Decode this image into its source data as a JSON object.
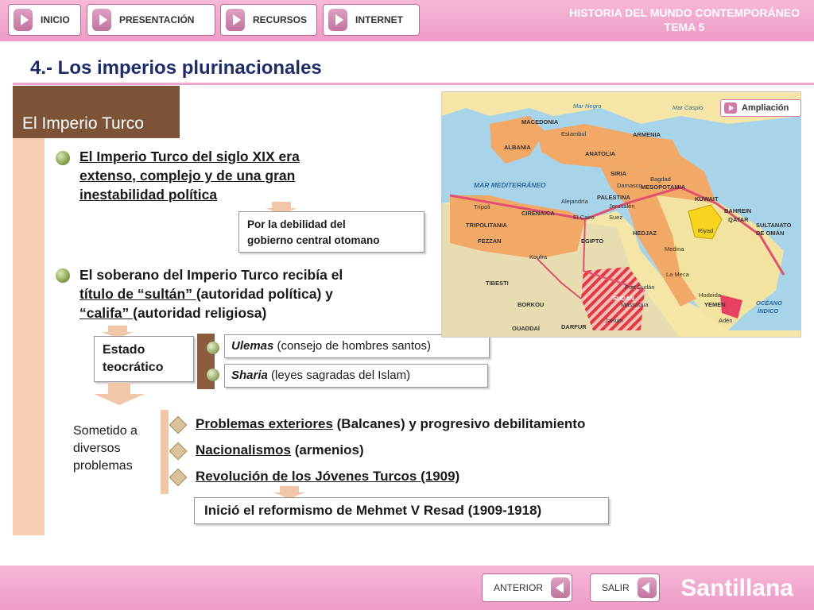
{
  "nav": {
    "inicio": "INICIO",
    "presentacion": "PRESENTACIÓN",
    "recursos": "RECURSOS",
    "internet": "INTERNET"
  },
  "course": {
    "line1": "HISTORIA DEL MUNDO CONTEMPORÁNEO",
    "line2": "TEMA 5"
  },
  "page_title": "4.- Los imperios plurinacionales",
  "section_header": "El Imperio Turco",
  "ampliacion_label": "Ampliación",
  "point1": {
    "lines": [
      "El Imperio Turco del siglo XIX era",
      "extenso, complejo y de una gran",
      "inestabilidad política"
    ],
    "note_lines": [
      "Por la debilidad del",
      "gobierno central otomano"
    ]
  },
  "point2": {
    "line1": "El soberano del Imperio Turco recibía el",
    "line2_u": "título de “sultán” ",
    "line2_rest": "(autoridad política) y",
    "line3_u": "“califa” ",
    "line3_rest": "(autoridad religiosa)"
  },
  "estado": [
    "Estado",
    "teocrático"
  ],
  "ulemas": {
    "term": "Ulemas",
    "desc": " (consejo de hombres santos)"
  },
  "sharia": {
    "term": "Sharia",
    "desc": " (leyes sagradas del Islam)"
  },
  "sometido": [
    "Sometido a",
    "diversos",
    "problemas"
  ],
  "problems": [
    {
      "u": "Problemas exteriores",
      "rest": " (Balcanes) y progresivo debilitamiento"
    },
    {
      "u": "Nacionalismos",
      "rest": " (armenios)"
    },
    {
      "u": "Revolución de los Jóvenes Turcos (1909)",
      "rest": ""
    }
  ],
  "reform": "Inició el reformismo de Mehmet V Resad (1909-1918)",
  "map_labels": {
    "macedonia": "MACEDONIA",
    "estambul": "Estambul",
    "albania": "ALBANIA",
    "anatolia": "ANATOLIA",
    "armenia": "ARMENIA",
    "mar_negro": "Mar Negro",
    "mar_caspio": "Mar Caspio",
    "mediterraneo": "MAR MEDITERRÁNEO",
    "siria": "SIRIA",
    "damasco": "Damasco",
    "mesopotamia": "MESOPOTAMIA",
    "bagdad": "Bagdad",
    "palestina": "PALESTINA",
    "jerusalen": "Jerusalén",
    "suez": "Suez",
    "kuwait": "KUWAIT",
    "bahrein": "BAHREIN",
    "qatar": "QATAR",
    "tripoli": "Trípoli",
    "tripolitania": "TRIPOLITANIA",
    "cirenaica": "CIRENAICA",
    "alejandria": "Alejandría",
    "el_cairo": "El Cairo",
    "hedjaz": "HEDJAZ",
    "riyad": "Riyad",
    "sultanato": "SULTANATO",
    "de_oman": "DE OMÁN",
    "fezzan": "FEZZAN",
    "egipto": "EGIPTO",
    "medina": "Medina",
    "koufra": "Koufra",
    "la_meca": "La Meca",
    "tibesti": "TIBESTI",
    "port_sudan": "Port Sudán",
    "massaoua": "Massaoua",
    "sudan": "SUDÁN",
    "borkou": "BORKOU",
    "hodeida": "Hodeida",
    "yemen": "YEMEN",
    "aden": "Adén",
    "jartum": "Jartum",
    "ouaddai": "OUADDAÏ",
    "darfur": "DARFUR",
    "oceano": "OCÉANO",
    "indico": "ÍNDICO"
  },
  "footer": {
    "anterior": "ANTERIOR",
    "salir": "SALIR",
    "brand": "Santillana"
  },
  "colors": {
    "pink": "#ee9bc7",
    "brown": "#7c5337",
    "title_blue": "#1e2d6a",
    "peach": "#f7cfb2"
  }
}
